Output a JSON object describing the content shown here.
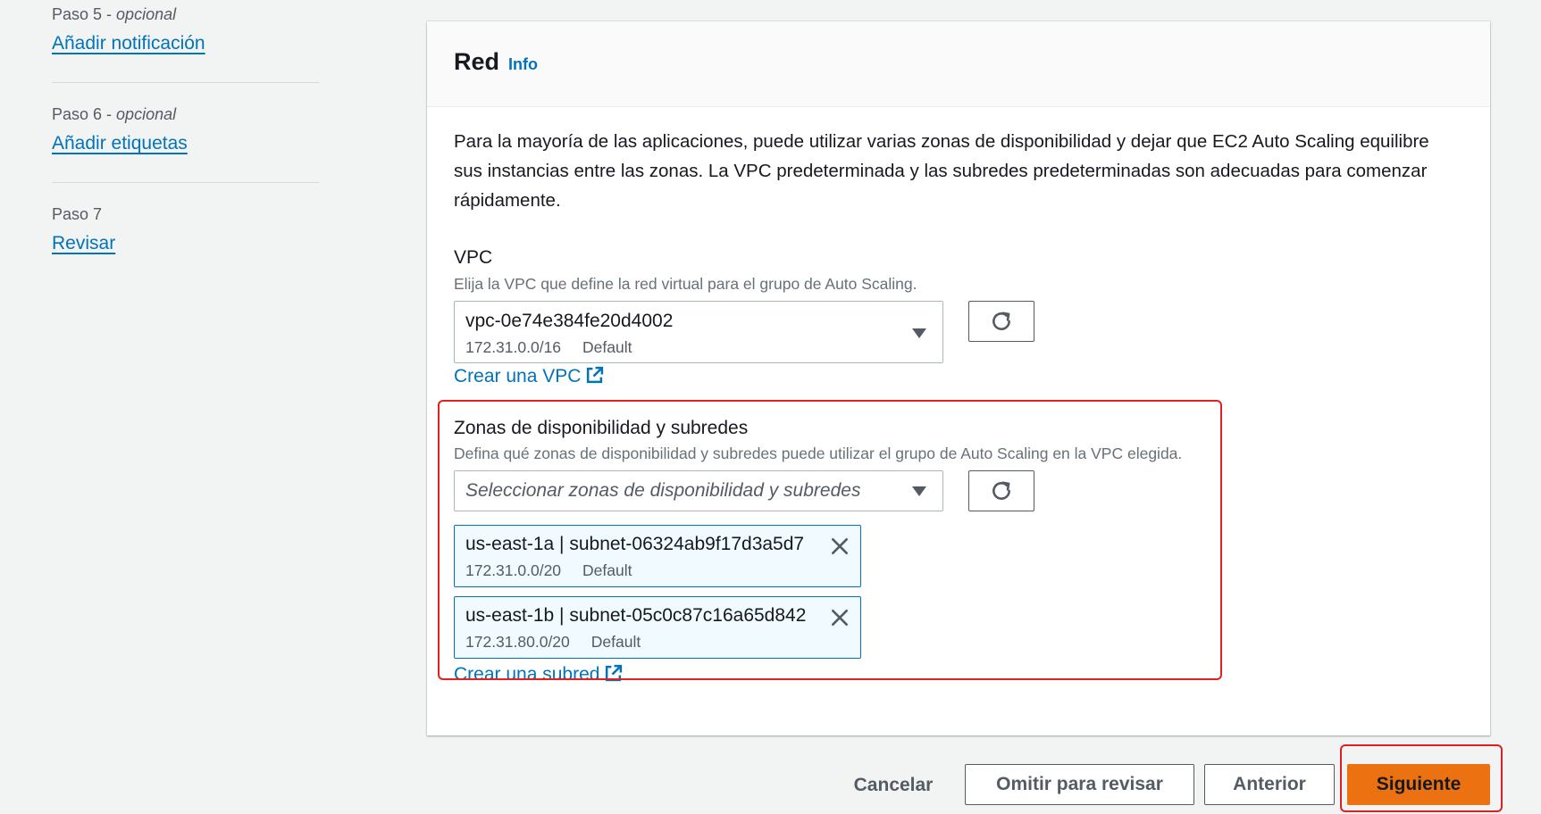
{
  "steps": [
    {
      "label": "Paso 5",
      "optional": "opcional",
      "link": "Añadir notificación"
    },
    {
      "label": "Paso 6",
      "optional": "opcional",
      "link": "Añadir etiquetas"
    },
    {
      "label": "Paso 7",
      "optional": "",
      "link": "Revisar"
    }
  ],
  "card": {
    "title": "Red",
    "info": "Info",
    "description": "Para la mayoría de las aplicaciones, puede utilizar varias zonas de disponibilidad y dejar que EC2 Auto Scaling equilibre sus instancias entre las zonas. La VPC predeterminada y las subredes predeterminadas son adecuadas para comenzar rápidamente."
  },
  "vpc": {
    "label": "VPC",
    "hint": "Elija la VPC que define la red virtual para el grupo de Auto Scaling.",
    "selected_id": "vpc-0e74e384fe20d4002",
    "selected_cidr": "172.31.0.0/16",
    "selected_tag": "Default",
    "create_link": "Crear una VPC"
  },
  "zones": {
    "label": "Zonas de disponibilidad y subredes",
    "hint": "Defina qué zonas de disponibilidad y subredes puede utilizar el grupo de Auto Scaling en la VPC elegida.",
    "placeholder": "Seleccionar zonas de disponibilidad y subredes",
    "tokens": [
      {
        "title": "us-east-1a | subnet-06324ab9f17d3a5d7",
        "cidr": "172.31.0.0/20",
        "tag": "Default"
      },
      {
        "title": "us-east-1b | subnet-05c0c87c16a65d842",
        "cidr": "172.31.80.0/20",
        "tag": "Default"
      }
    ],
    "create_link": "Crear una subred"
  },
  "footer": {
    "cancel": "Cancelar",
    "skip": "Omitir para revisar",
    "previous": "Anterior",
    "next": "Siguiente"
  },
  "colors": {
    "link": "#0073bb",
    "primary": "#ec7211",
    "highlight": "#e02020"
  },
  "icons": [
    "refresh-icon",
    "external-link-icon",
    "close-icon",
    "caret-down-icon"
  ]
}
